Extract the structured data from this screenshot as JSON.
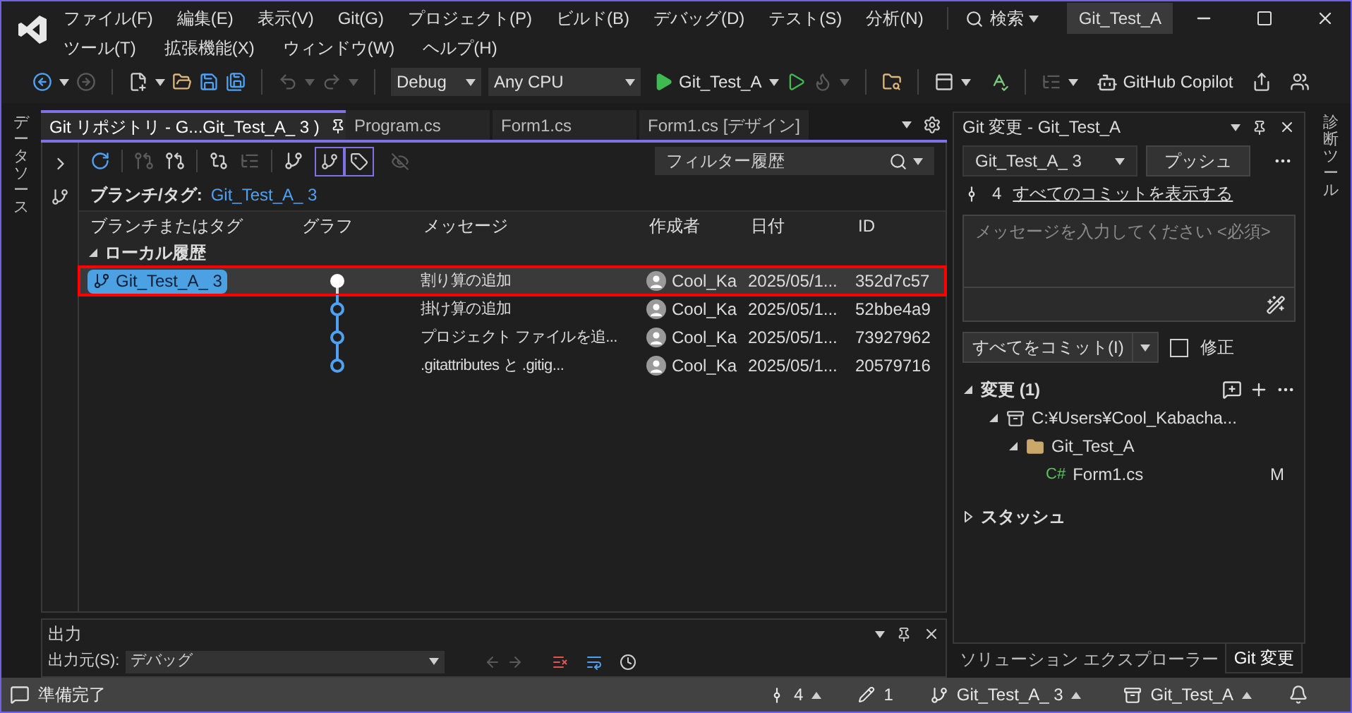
{
  "menu_rows": [
    [
      "ファイル(F)",
      "編集(E)",
      "表示(V)",
      "Git(G)",
      "プロジェクト(P)",
      "ビルド(B)",
      "デバッグ(D)",
      "テスト(S)",
      "分析(N)"
    ],
    [
      "ツール(T)",
      "拡張機能(X)",
      "ウィンドウ(W)",
      "ヘルプ(H)"
    ]
  ],
  "search": {
    "label": "検索"
  },
  "solution_name": "Git_Test_A",
  "toolbar": {
    "configuration": "Debug",
    "platform": "Any CPU",
    "startup": "Git_Test_A",
    "copilot": "GitHub Copilot"
  },
  "side_tabs": {
    "left": "データソース",
    "right": "診断ツール"
  },
  "doc_tabs": [
    {
      "label": "Git リポジトリ - G...Git_Test_A_ 3 )",
      "selected": true
    },
    {
      "label": "Program.cs",
      "selected": false
    },
    {
      "label": "Form1.cs",
      "selected": false
    },
    {
      "label": "Form1.cs [デザイン]",
      "selected": false
    }
  ],
  "git_repo": {
    "toggle_buttons": [
      {
        "on": true
      },
      {
        "on": true
      },
      {
        "on": false
      }
    ],
    "filter_placeholder": "フィルター履歴",
    "branch_label": "ブランチ/タグ:",
    "branch_value": "Git_Test_A_ 3",
    "columns": [
      "ブランチまたはタグ",
      "グラフ",
      "メッセージ",
      "作成者",
      "日付",
      "ID"
    ],
    "group": {
      "label": "ローカル履歴",
      "expanded": true
    },
    "rows": [
      {
        "branch": "Git_Test_A_ 3",
        "message": "割り算の追加",
        "author": "Cool_Ka",
        "date": "2025/05/1...",
        "id": "352d7c57",
        "selected": true
      },
      {
        "message": "掛け算の追加",
        "author": "Cool_Ka",
        "date": "2025/05/1...",
        "id": "52bbe4a9",
        "selected": false
      },
      {
        "message": "プロジェクト ファイルを追...",
        "author": "Cool_Ka",
        "date": "2025/05/1...",
        "id": "73927962",
        "selected": false
      },
      {
        "message": ".gitattributes と .gitig...",
        "author": "Cool_Ka",
        "date": "2025/05/1...",
        "id": "20579716",
        "selected": false
      }
    ]
  },
  "output": {
    "title": "出力",
    "source_label": "出力元(S):",
    "source_value": "デバッグ"
  },
  "git_changes": {
    "title": "Git 変更 - Git_Test_A",
    "branch": "Git_Test_A_ 3",
    "push": "プッシュ",
    "commit_count": "4",
    "view_all": "すべてのコミットを表示する",
    "message_placeholder": "メッセージを入力してください <必須>",
    "commit_button": "すべてをコミット(I)",
    "amend": {
      "label": "修正",
      "checked": false
    },
    "changes_header": {
      "label": "変更 (1)",
      "expanded": true
    },
    "tree": [
      {
        "label": "C:¥Users¥Cool_Kabacha...",
        "kind": "repo",
        "expanded": true,
        "children": [
          {
            "label": "Git_Test_A",
            "kind": "folder",
            "expanded": true,
            "children": [
              {
                "label": "Form1.cs",
                "kind": "file",
                "type_label": "C#",
                "status": "M"
              }
            ]
          }
        ]
      }
    ],
    "stash": {
      "label": "スタッシュ",
      "expanded": false
    }
  },
  "panel_tabs": [
    {
      "label": "ソリューション エクスプローラー",
      "selected": false
    },
    {
      "label": "Git 変更",
      "selected": true
    }
  ],
  "status_bar": {
    "message": "準備完了",
    "commits": "4",
    "changes": "1",
    "branch": "Git_Test_A_ 3",
    "repo": "Git_Test_A"
  }
}
